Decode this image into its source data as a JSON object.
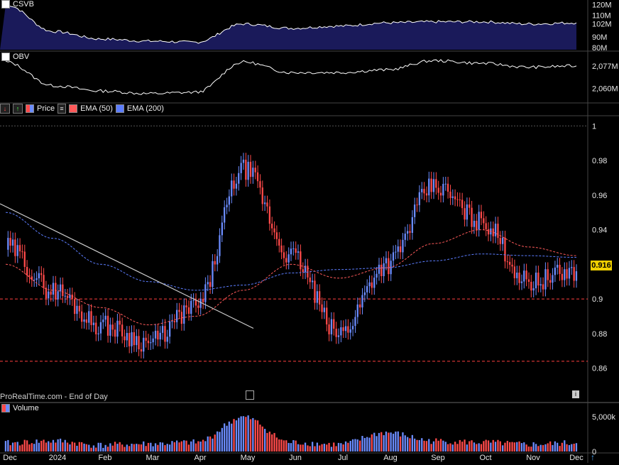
{
  "panels": {
    "csvb": {
      "title": "CSVB",
      "y_ticks": [
        "120M",
        "110M",
        "102M",
        "90M",
        "80M"
      ]
    },
    "obv": {
      "title": "OBV",
      "y_ticks": [
        "2,077M",
        "2,060M"
      ]
    },
    "price": {
      "legend": [
        "Price",
        "EMA (50)",
        "EMA (200)"
      ],
      "y_ticks": [
        "1",
        "0.98",
        "0.96",
        "0.94",
        "0.92",
        "0.9",
        "0.88",
        "0.86"
      ],
      "last_price": "0.916"
    },
    "volume": {
      "title": "Volume",
      "y_ticks": [
        "5,000k",
        "0"
      ]
    }
  },
  "watermark": "ProRealTime.com - End of Day",
  "x_axis": {
    "labels": [
      "Dec",
      "2024",
      "Feb",
      "Mar",
      "Apr",
      "May",
      "Jun",
      "Jul",
      "Aug",
      "Sep",
      "Oct",
      "Nov",
      "Dec"
    ]
  },
  "colors": {
    "up": "#6b8cff",
    "down": "#ff4a4a",
    "ema50": "#ff5a5a",
    "ema200": "#5c7dff",
    "csvb_fill": "#1a1a5a",
    "line": "#ffffff",
    "trend": "#cfcfcf",
    "level": "#ff4040",
    "last_price_bg": "#f0d000"
  },
  "chart_data": {
    "type": "candlestick",
    "x": [
      "2023-12",
      "2024-01",
      "2024-02",
      "2024-03",
      "2024-04",
      "2024-05",
      "2024-06",
      "2024-07",
      "2024-08",
      "2024-09",
      "2024-10",
      "2024-11",
      "2024-12"
    ],
    "price_close": [
      0.93,
      0.905,
      0.885,
      0.875,
      0.895,
      0.975,
      0.925,
      0.88,
      0.92,
      0.965,
      0.945,
      0.91,
      0.916
    ],
    "ema50": [
      0.92,
      0.905,
      0.895,
      0.885,
      0.89,
      0.905,
      0.92,
      0.912,
      0.918,
      0.932,
      0.94,
      0.93,
      0.925
    ],
    "ema200": [
      0.95,
      0.935,
      0.92,
      0.91,
      0.905,
      0.908,
      0.915,
      0.917,
      0.918,
      0.922,
      0.926,
      0.925,
      0.924
    ],
    "price_ylim": [
      0.843,
      1.003
    ],
    "horizontal_levels": [
      0.9,
      0.864
    ],
    "trendline": {
      "from": [
        "2023-12",
        0.955
      ],
      "to": [
        "2024-05",
        0.883
      ]
    },
    "volume_k": [
      1200,
      1500,
      900,
      1100,
      1300,
      4900,
      1300,
      1000,
      2700,
      1500,
      1300,
      1000,
      1200
    ],
    "volume_ylim": [
      0,
      6500
    ],
    "csvb_m": [
      120,
      95,
      88,
      86,
      85,
      102,
      98,
      100,
      103,
      104,
      104,
      102,
      103
    ],
    "csvb_ylim": [
      78,
      123
    ],
    "obv_m": [
      2080,
      2062,
      2058,
      2056,
      2057,
      2080,
      2072,
      2072,
      2074,
      2081,
      2079,
      2076,
      2077
    ],
    "obv_ylim": [
      2050,
      2085
    ],
    "grid": false
  }
}
